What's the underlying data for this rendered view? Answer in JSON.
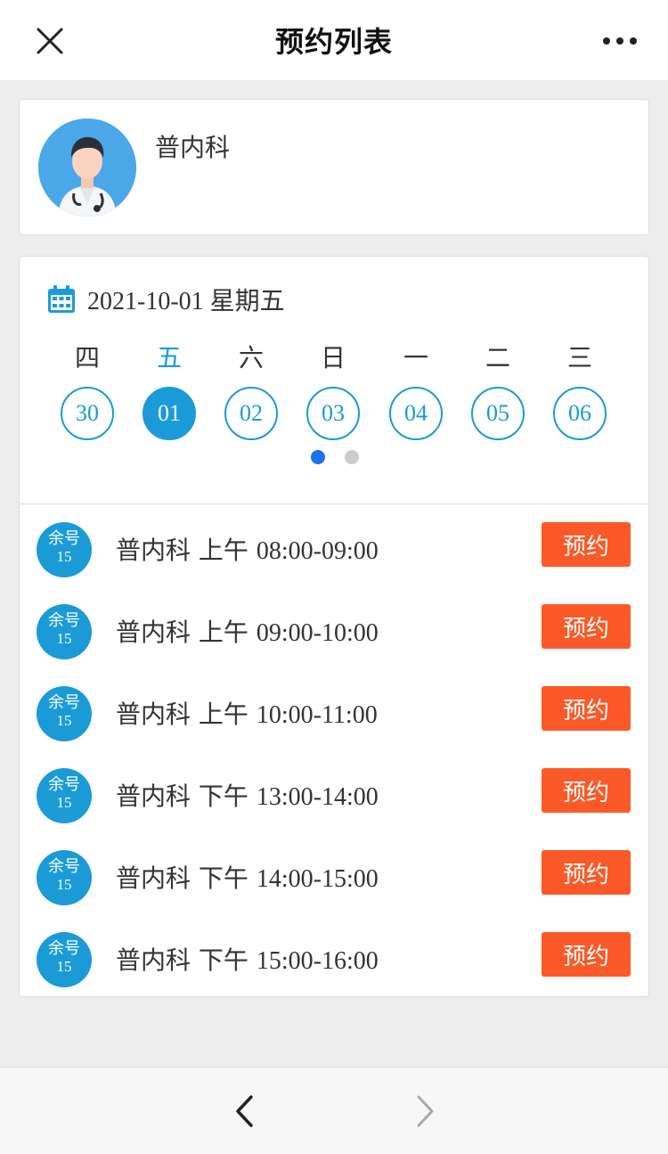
{
  "header": {
    "title": "预约列表",
    "close_icon": "close-icon",
    "more_icon": "more-icon"
  },
  "department": {
    "name": "普内科",
    "avatar_icon": "doctor-avatar"
  },
  "calendar": {
    "icon": "calendar-icon",
    "date": "2021-10-01",
    "weekday": "星期五",
    "week_labels": [
      "四",
      "五",
      "六",
      "日",
      "一",
      "二",
      "三"
    ],
    "days": [
      "30",
      "01",
      "02",
      "03",
      "04",
      "05",
      "06"
    ],
    "selected_index": 1,
    "page_dots": 2,
    "active_page": 0,
    "accent_color": "#1a9bd7"
  },
  "slots": [
    {
      "badge_label": "余号",
      "remaining": "15",
      "dept": "普内科",
      "period": "上午",
      "time": "08:00-09:00",
      "button": "预约"
    },
    {
      "badge_label": "余号",
      "remaining": "15",
      "dept": "普内科",
      "period": "上午",
      "time": "09:00-10:00",
      "button": "预约"
    },
    {
      "badge_label": "余号",
      "remaining": "15",
      "dept": "普内科",
      "period": "上午",
      "time": "10:00-11:00",
      "button": "预约"
    },
    {
      "badge_label": "余号",
      "remaining": "15",
      "dept": "普内科",
      "period": "下午",
      "time": "13:00-14:00",
      "button": "预约"
    },
    {
      "badge_label": "余号",
      "remaining": "15",
      "dept": "普内科",
      "period": "下午",
      "time": "14:00-15:00",
      "button": "预约"
    },
    {
      "badge_label": "余号",
      "remaining": "15",
      "dept": "普内科",
      "period": "下午",
      "time": "15:00-16:00",
      "button": "预约"
    }
  ],
  "button_color": "#fb5a28",
  "bottom_nav": {
    "back_icon": "chevron-left-icon",
    "forward_icon": "chevron-right-icon"
  }
}
